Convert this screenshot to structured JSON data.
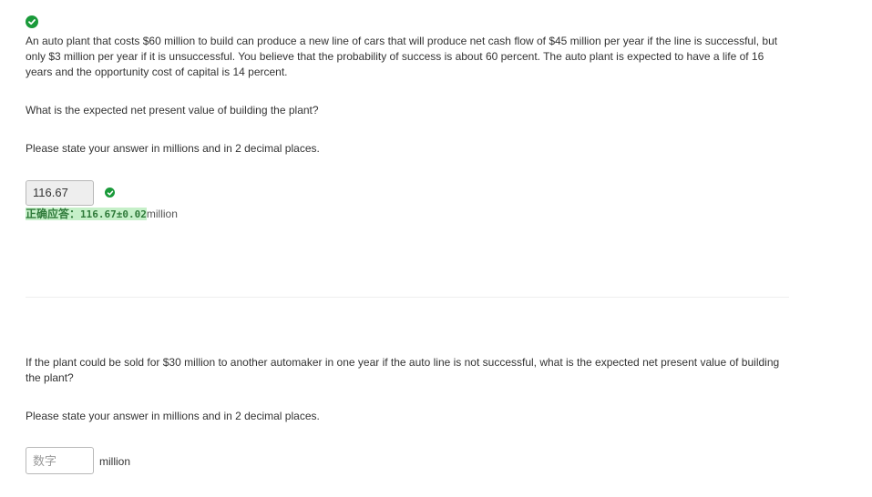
{
  "part1": {
    "status_icon": "check-circle-icon",
    "problem_text": "An auto plant that costs $60 million to build can produce a new line of cars that will produce net cash flow of $45 million per year if the line is successful, but only $3 million per year if it is unsuccessful. You believe that the probability of success is about 60 percent. The auto plant is expected to have a life of 16 years and the opportunity cost of capital is 14 percent.",
    "question": "What is the expected net present value of building the plant?",
    "instruction": "Please state your answer in millions and in 2 decimal places.",
    "answer_value": "116.67",
    "answer_status_icon": "check-circle-icon",
    "correct_answer_label": "正确应答：",
    "correct_answer_value": "116.67±0.02",
    "unit": "million"
  },
  "part2": {
    "question": "If the plant could be sold for $30 million to another automaker in one year if the auto line is not successful, what is the expected net present value of building the plant?",
    "instruction": "Please state your answer in millions and in 2 decimal places.",
    "answer_value": "",
    "answer_placeholder": "数字",
    "unit": "million"
  },
  "colors": {
    "success": "#1a9a3a",
    "highlight_bg": "#c6f0c9",
    "highlight_text": "#2f7a3a",
    "text": "#333333"
  }
}
